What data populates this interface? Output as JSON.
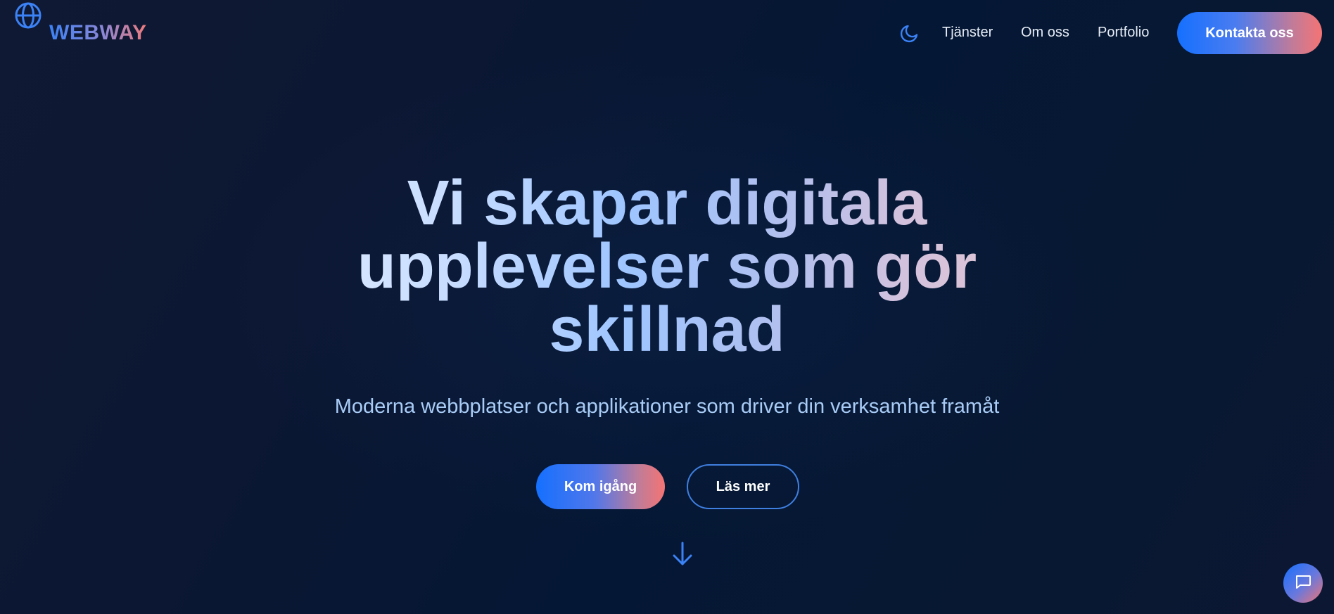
{
  "header": {
    "logo_text": "WEBWAY",
    "logo_icon": "globe-icon",
    "theme_toggle_icon": "moon-icon",
    "nav": [
      {
        "label": "Tjänster"
      },
      {
        "label": "Om oss"
      },
      {
        "label": "Portfolio"
      }
    ],
    "contact_label": "Kontakta oss"
  },
  "hero": {
    "title": "Vi skapar digitala upplevelser som gör skillnad",
    "subtitle": "Moderna webbplatser och applikationer som driver din verksamhet framåt",
    "primary_cta": "Kom igång",
    "secondary_cta": "Läs mer",
    "scroll_icon": "arrow-down-icon"
  },
  "chat": {
    "icon": "chat-bubble-icon"
  },
  "colors": {
    "accent_blue": "#1570ff",
    "accent_coral": "#f47474",
    "background": "#041734",
    "subtitle": "#a9ccf6"
  }
}
